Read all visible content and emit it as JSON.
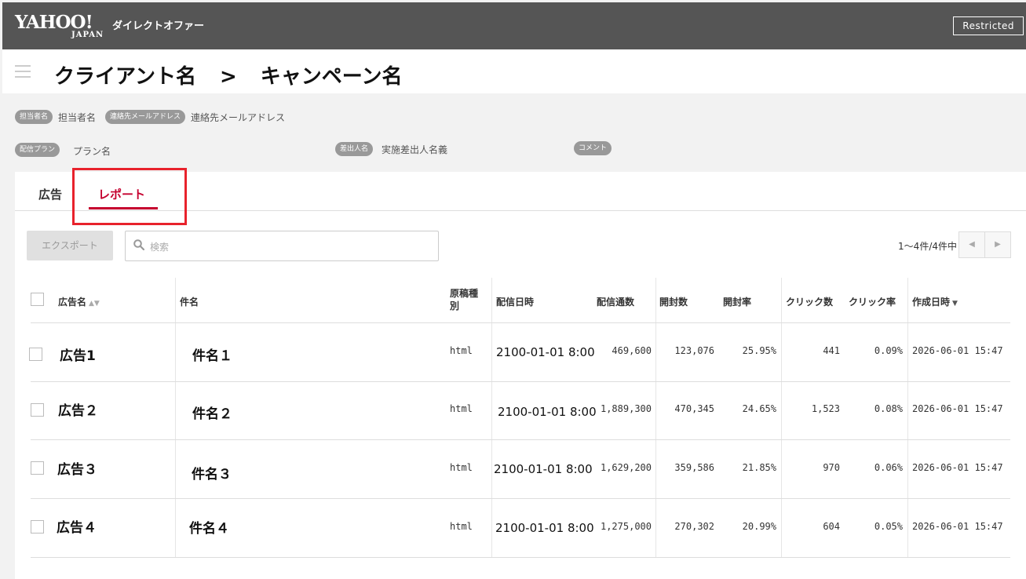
{
  "header": {
    "logo_yahoo": "YAHOO!",
    "logo_japan": "JAPAN",
    "service_name": "ダイレクトオファー",
    "restricted_label": "Restricted"
  },
  "title": {
    "client": "クライアント名",
    "separator": ">",
    "campaign": "キャンペーン名"
  },
  "meta": {
    "manager_pill": "担当者名",
    "manager_value": "担当者名",
    "email_pill": "連絡先メールアドレス",
    "email_value": "連絡先メールアドレス",
    "plan_pill": "配信プラン",
    "plan_value": "プラン名",
    "sender_pill": "差出人名",
    "sender_value": "実施差出人名義",
    "comment_pill": "コメント"
  },
  "tabs": {
    "ads": "広告",
    "report": "レポート"
  },
  "toolbar": {
    "export_label": "エクスポート",
    "search_placeholder": "検索",
    "pager_text": "1〜4件/4件中",
    "prev": "◀",
    "next": "▶"
  },
  "table": {
    "headers": {
      "ad_name": "広告名",
      "subject": "件名",
      "type": "原稿種別",
      "delivery_date": "配信日時",
      "sent": "配信通数",
      "opens": "開封数",
      "open_rate": "開封率",
      "clicks": "クリック数",
      "click_rate": "クリック率",
      "created": "作成日時"
    },
    "sort_both": "▲▼",
    "sort_desc": "▼",
    "rows": [
      {
        "ad_name": "広告1",
        "subject": "件名１",
        "type": "html",
        "delivery_date": "2100-01-01 8:00",
        "sent": "469,600",
        "opens": "123,076",
        "open_rate": "25.95%",
        "clicks": "441",
        "click_rate": "0.09%",
        "created": "2026-06-01 15:47"
      },
      {
        "ad_name": "広告２",
        "subject": "件名２",
        "type": "html",
        "delivery_date": "2100-01-01 8:00",
        "sent": "1,889,300",
        "opens": "470,345",
        "open_rate": "24.65%",
        "clicks": "1,523",
        "click_rate": "0.08%",
        "created": "2026-06-01 15:47"
      },
      {
        "ad_name": "広告３",
        "subject": "件名３",
        "type": "html",
        "delivery_date": "2100-01-01 8:00",
        "sent": "1,629,200",
        "opens": "359,586",
        "open_rate": "21.85%",
        "clicks": "970",
        "click_rate": "0.06%",
        "created": "2026-06-01 15:47"
      },
      {
        "ad_name": "広告４",
        "subject": "件名４",
        "type": "html",
        "delivery_date": "2100-01-01 8:00",
        "sent": "1,275,000",
        "opens": "270,302",
        "open_rate": "20.99%",
        "clicks": "604",
        "click_rate": "0.05%",
        "created": "2026-06-01 15:47"
      }
    ]
  }
}
